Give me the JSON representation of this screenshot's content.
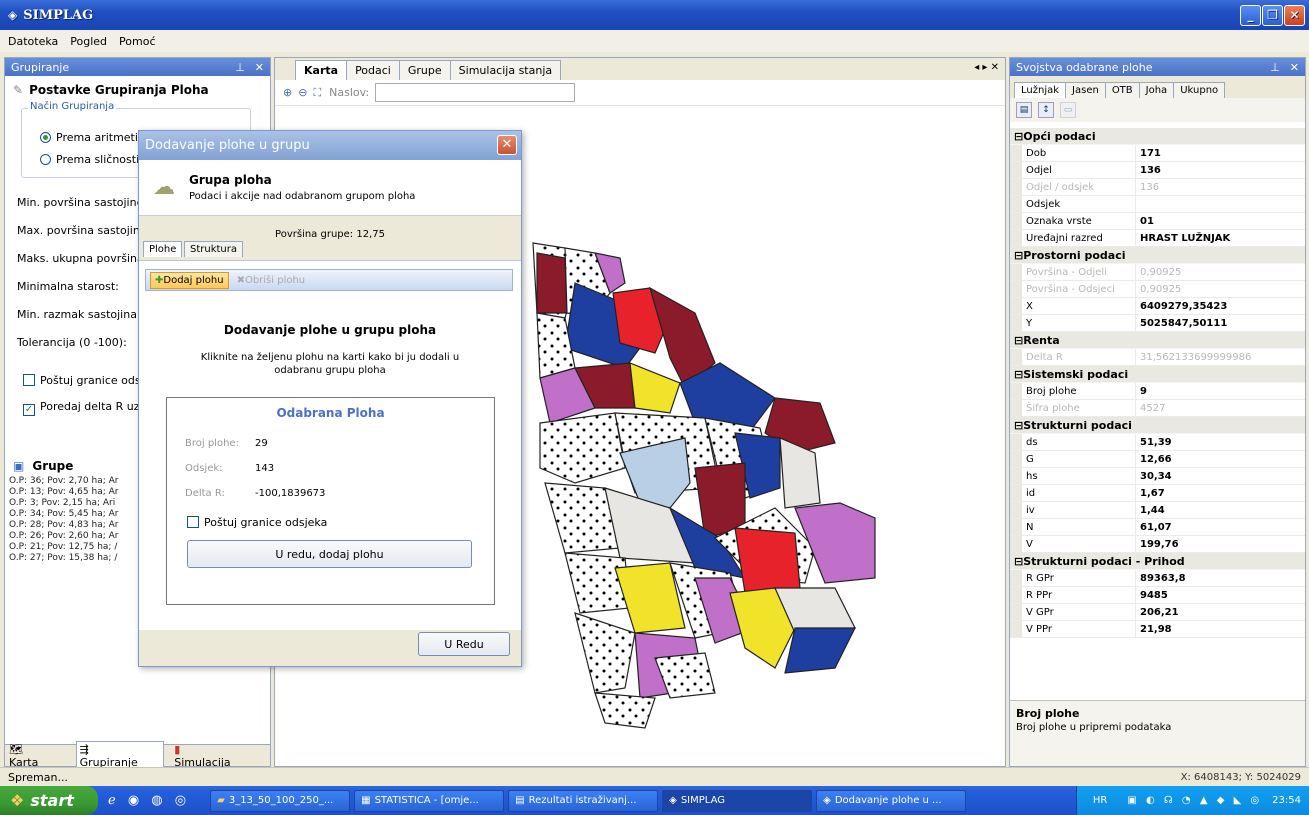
{
  "window": {
    "title": "SIMPLAG"
  },
  "menu": [
    "Datoteka",
    "Pogled",
    "Pomoć"
  ],
  "left": {
    "header": "Grupiranje",
    "section_title": "Postavke Grupiranja Ploha",
    "method_group": "Način Grupiranja",
    "method_options": [
      "Prema aritmetič",
      "Prema sličnosti"
    ],
    "fields": [
      "Min. površina sastojine:",
      "Max. površina sastojine",
      "Maks. ukupna površina:",
      "Minimalna starost:",
      "Min. razmak sastojina:",
      "Tolerancija (0 -100):"
    ],
    "checks": [
      "Poštuj granice odsje",
      "Poredaj delta R uzla"
    ],
    "groups_title": "Grupe",
    "groups": [
      "O.P: 36; Pov: 2,70 ha; Ar",
      "O.P: 13; Pov: 4,65 ha; Ar",
      "O.P: 3; Pov: 2,15 ha; Ari",
      "O.P: 34; Pov: 5,45 ha; Ar",
      "O.P: 28; Pov: 4,83 ha; Ar",
      "O.P: 26; Pov: 2,60 ha; Ar",
      "O.P: 21; Pov: 12,75 ha; /",
      "O.P: 27; Pov: 15,38 ha; /"
    ],
    "bottom_tabs": [
      "Karta",
      "Grupiranje",
      "Simulacija"
    ]
  },
  "center": {
    "tabs": [
      "Karta",
      "Podaci",
      "Grupe",
      "Simulacija stanja"
    ],
    "title_label": "Naslov:",
    "title_value": ""
  },
  "right": {
    "header": "Svojstva odabrane plohe",
    "tabs": [
      "Lužnjak",
      "Jasen",
      "OTB",
      "Joha",
      "Ukupno"
    ],
    "categories": [
      {
        "name": "Opći podaci",
        "rows": [
          {
            "k": "Dob",
            "v": "171",
            "dis": false
          },
          {
            "k": "Odjel",
            "v": "136",
            "dis": false
          },
          {
            "k": "Odjel / odsjek",
            "v": "136",
            "dis": true
          },
          {
            "k": "Odsjek",
            "v": "",
            "dis": false
          },
          {
            "k": "Oznaka vrste",
            "v": "01",
            "dis": false
          },
          {
            "k": "Uređajni razred",
            "v": "HRAST LUŽNJAK",
            "dis": false
          }
        ]
      },
      {
        "name": "Prostorni podaci",
        "rows": [
          {
            "k": "Površina - Odjeli",
            "v": "0,90925",
            "dis": true
          },
          {
            "k": "Površina - Odsjeci",
            "v": "0,90925",
            "dis": true
          },
          {
            "k": "X",
            "v": "6409279,35423",
            "dis": false
          },
          {
            "k": "Y",
            "v": "5025847,50111",
            "dis": false
          }
        ]
      },
      {
        "name": "Renta",
        "rows": [
          {
            "k": "Delta R",
            "v": "31,562133699999986",
            "dis": true
          }
        ]
      },
      {
        "name": "Sistemski podaci",
        "rows": [
          {
            "k": "Broj plohe",
            "v": "9",
            "dis": false
          },
          {
            "k": "Šifra plohe",
            "v": "4527",
            "dis": true
          }
        ]
      },
      {
        "name": "Strukturni podaci",
        "rows": [
          {
            "k": "ds",
            "v": "51,39",
            "dis": false
          },
          {
            "k": "G",
            "v": "12,66",
            "dis": false
          },
          {
            "k": "hs",
            "v": "30,34",
            "dis": false
          },
          {
            "k": "id",
            "v": "1,67",
            "dis": false
          },
          {
            "k": "iv",
            "v": "1,44",
            "dis": false
          },
          {
            "k": "N",
            "v": "61,07",
            "dis": false
          },
          {
            "k": "V",
            "v": "199,76",
            "dis": false
          }
        ]
      },
      {
        "name": "Strukturni podaci - Prihod",
        "rows": [
          {
            "k": "R GPr",
            "v": "89363,8",
            "dis": false
          },
          {
            "k": "R PPr",
            "v": "9485",
            "dis": false
          },
          {
            "k": "V GPr",
            "v": "206,21",
            "dis": false
          },
          {
            "k": "V PPr",
            "v": "21,98",
            "dis": false
          }
        ]
      }
    ],
    "help_title": "Broj plohe",
    "help_text": "Broj plohe u pripremi podataka"
  },
  "dialog": {
    "title": "Dodavanje plohe u grupu",
    "head_title": "Grupa ploha",
    "head_sub": "Podaci i akcije nad odabranom grupom ploha",
    "area": "Površina grupe: 12,75",
    "tabs": [
      "Plohe",
      "Struktura"
    ],
    "tool_add": "Dodaj plohu",
    "tool_remove": "Obriši plohu",
    "body_title": "Dodavanje plohe u grupu ploha",
    "body_text": "Kliknite na željenu plohu na karti kako bi ju dodali u odabranu grupu ploha",
    "sel_title": "Odabrana Ploha",
    "sel_rows": [
      {
        "k": "Broj plohe:",
        "v": "29"
      },
      {
        "k": "Odsjek:",
        "v": "143"
      },
      {
        "k": "Delta R:",
        "v": "-100,1839673"
      }
    ],
    "sel_check": "Poštuj granice odsjeka",
    "sel_button": "U redu, dodaj plohu",
    "ok": "U Redu"
  },
  "status": {
    "left": "Spreman...",
    "right": "X: 6408143; Y: 5024029"
  },
  "taskbar": {
    "start": "start",
    "items": [
      "3_13_50_100_250_...",
      "STATISTICA - [omje...",
      "Rezultati istraživanj...",
      "SIMPLAG",
      "Dodavanje plohe u ..."
    ],
    "lang": "HR",
    "clock": "23:54"
  },
  "colors": {
    "xp_blue": "#245edb",
    "map_darkred": "#8b1a2b",
    "map_red": "#e8222b",
    "map_blue": "#1f3fa0",
    "map_purple": "#c070c8",
    "map_yellow": "#f1e22a",
    "map_selected": "#b8cfe6"
  }
}
